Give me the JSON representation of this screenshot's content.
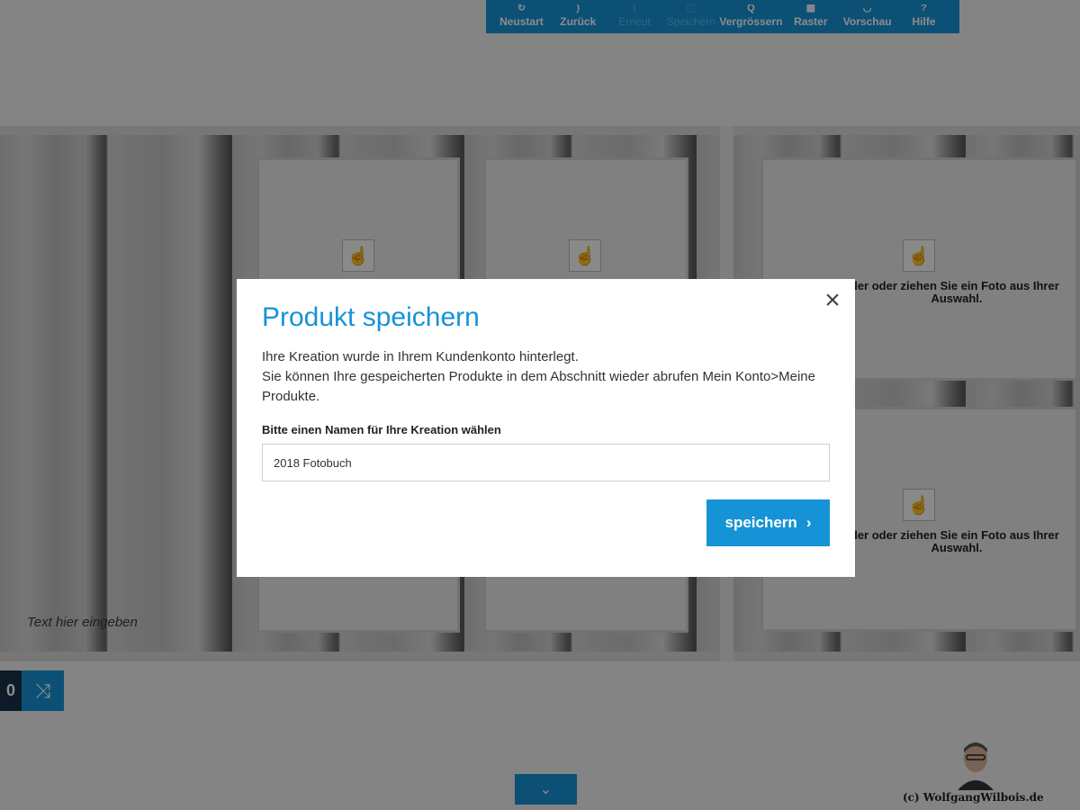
{
  "toolbar": {
    "items": [
      {
        "label": "Neustart",
        "icon": "refresh-icon",
        "enabled": true
      },
      {
        "label": "Zurück",
        "icon": "undo-icon",
        "enabled": true
      },
      {
        "label": "Erneut",
        "icon": "redo-icon",
        "enabled": false
      },
      {
        "label": "Speichern",
        "icon": "save-icon",
        "enabled": false
      },
      {
        "label": "Vergrössern",
        "icon": "zoom-icon",
        "enabled": true
      },
      {
        "label": "Raster",
        "icon": "grid-icon",
        "enabled": true
      },
      {
        "label": "Vorschau",
        "icon": "eye-icon",
        "enabled": true
      },
      {
        "label": "Hilfe",
        "icon": "help-icon",
        "enabled": true
      }
    ]
  },
  "book": {
    "text_placeholder": "Text hier eingeben",
    "slot_hint_right_top": "ler oder ziehen Sie ein Foto aus Ihrer Auswahl.",
    "slot_hint_right_bottom": "ler oder ziehen Sie ein Foto aus Ihrer Auswahl."
  },
  "controls": {
    "page_number": "0",
    "shuffle_icon": "shuffle-icon",
    "expand_icon": "chevron-down-icon"
  },
  "watermark": "(c) WolfgangWilbois.de",
  "modal": {
    "title": "Produkt speichern",
    "message_line1": "Ihre Kreation wurde in Ihrem Kundenkonto hinterlegt.",
    "message_line2": "Sie können Ihre gespeicherten Produkte in dem Abschnitt wieder abrufen Mein Konto>Meine Produkte.",
    "field_label": "Bitte einen Namen für Ihre Kreation wählen",
    "field_value": "2018 Fotobuch",
    "save_label": "speichern",
    "close_icon": "close-icon"
  },
  "colors": {
    "accent": "#1693d6",
    "dark": "#19324a"
  }
}
